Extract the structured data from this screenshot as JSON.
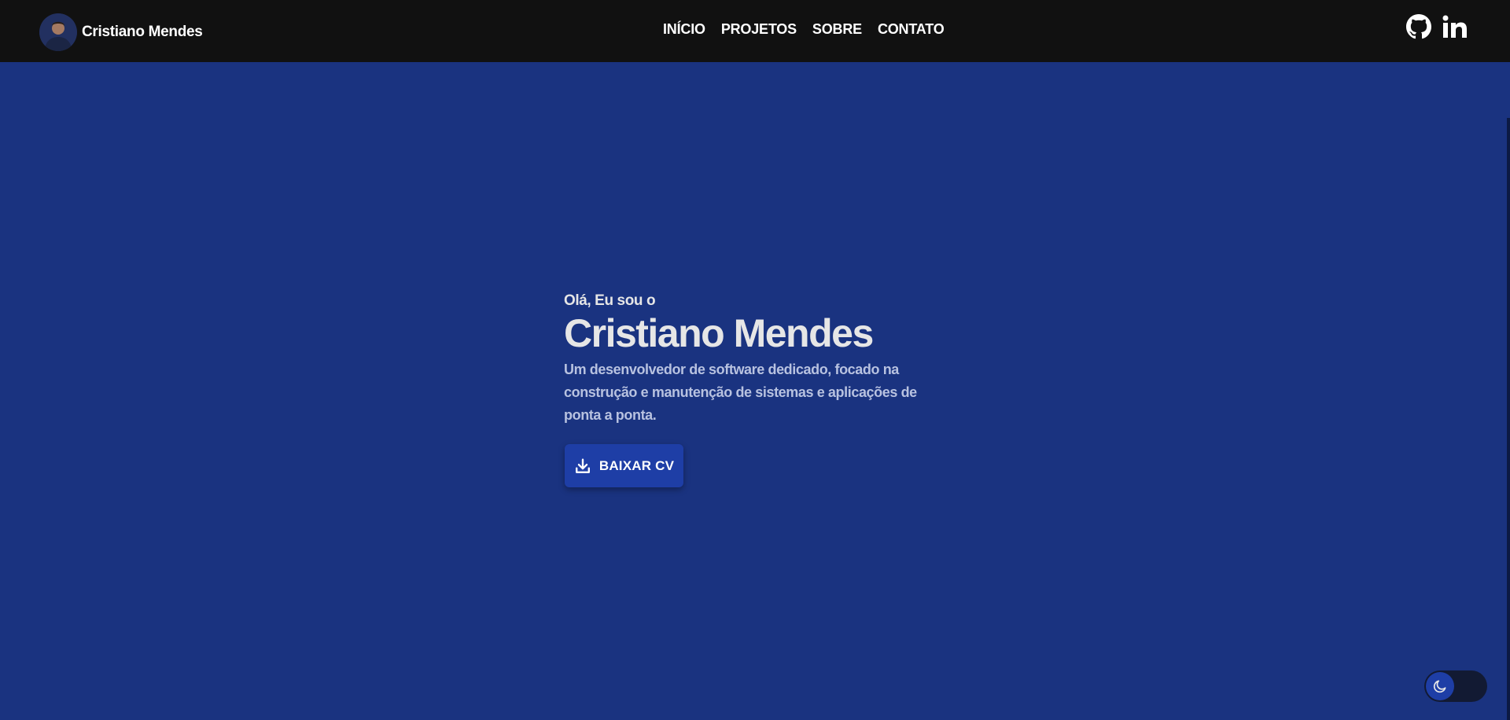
{
  "brand": {
    "name": "Cristiano Mendes"
  },
  "nav": {
    "items": [
      {
        "label": "INÍCIO"
      },
      {
        "label": "PROJETOS"
      },
      {
        "label": "SOBRE"
      },
      {
        "label": "CONTATO"
      }
    ]
  },
  "social": {
    "github_icon": "github-icon",
    "linkedin_icon": "linkedin-icon"
  },
  "hero": {
    "greeting": "Olá, Eu sou o",
    "name": "Cristiano Mendes",
    "description": "Um desenvolvedor de software dedicado, focado na construção e manutenção de sistemas e aplicações de ponta a ponta."
  },
  "cta": {
    "label": "BAIXAR CV",
    "icon": "download-icon"
  },
  "theme_toggle": {
    "icon": "moon-icon"
  },
  "colors": {
    "background": "#1a3380",
    "navbar": "#111111",
    "button": "#1e3ea6",
    "text": "#e6e6e6"
  }
}
